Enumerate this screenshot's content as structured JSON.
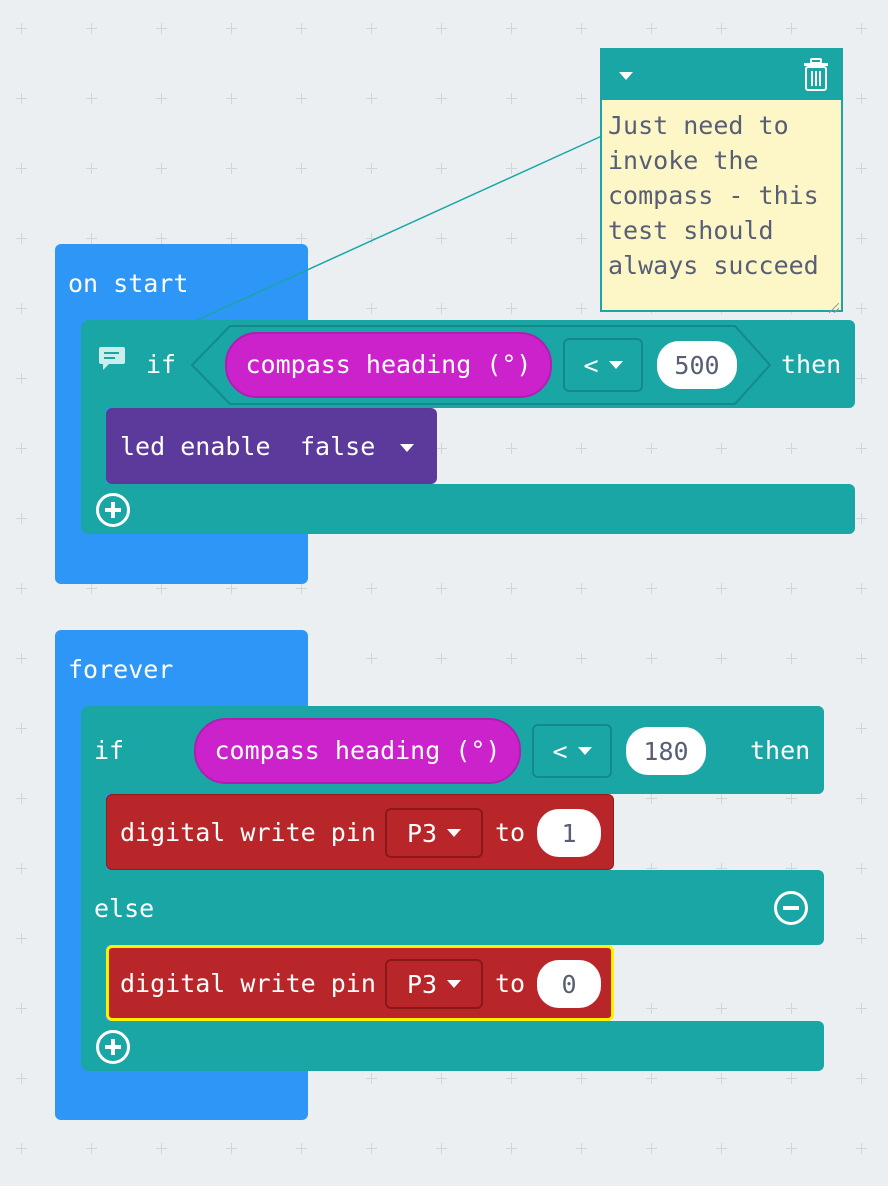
{
  "on_start": {
    "label": "on start",
    "if_label": "if",
    "condition_reporter": "compass heading (°)",
    "operator": "<",
    "compare_value": "500",
    "then_label": "then",
    "led_enable_label": "led enable",
    "led_enable_value": "false"
  },
  "comment": {
    "text": "Just need to invoke the compass - this test should always succeed"
  },
  "forever": {
    "label": "forever",
    "if_label": "if",
    "condition_reporter": "compass heading (°)",
    "operator": "<",
    "compare_value": "180",
    "then_label": "then",
    "write1": {
      "label": "digital write pin",
      "pin": "P3",
      "to_label": "to",
      "value": "1"
    },
    "else_label": "else",
    "write2": {
      "label": "digital write pin",
      "pin": "P3",
      "to_label": "to",
      "value": "0"
    }
  },
  "colors": {
    "event": "#2d96f6",
    "logic": "#1aa6a4",
    "input": "#cc22cc",
    "pins": "#b8262a",
    "led": "#5c3a9c",
    "selected_outline": "#fff200",
    "canvas": "#eceff1"
  }
}
